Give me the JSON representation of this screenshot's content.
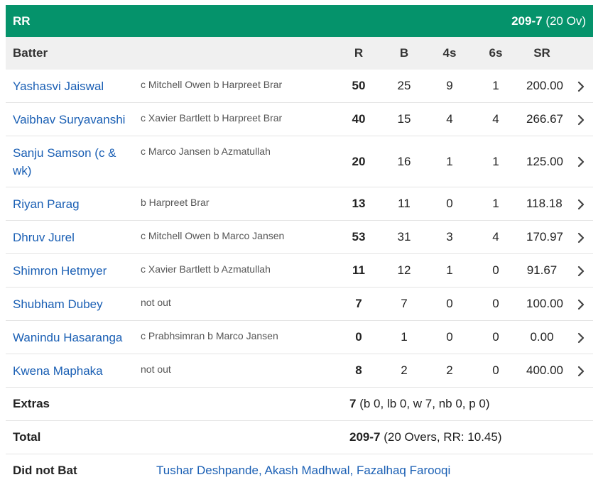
{
  "team": {
    "name": "RR",
    "score": "209-7",
    "overs": "(20 Ov)"
  },
  "columns": {
    "batter": "Batter",
    "runs": "R",
    "balls": "B",
    "fours": "4s",
    "sixes": "6s",
    "strike_rate": "SR"
  },
  "batters": [
    {
      "name": "Yashasvi Jaiswal",
      "dismissal": "c Mitchell Owen b Harpreet Brar",
      "r": "50",
      "b": "25",
      "fours": "9",
      "sixes": "1",
      "sr": "200.00"
    },
    {
      "name": "Vaibhav Suryavanshi",
      "dismissal": "c Xavier Bartlett b Harpreet Brar",
      "r": "40",
      "b": "15",
      "fours": "4",
      "sixes": "4",
      "sr": "266.67"
    },
    {
      "name": "Sanju Samson (c & wk)",
      "dismissal": "c Marco Jansen b Azmatullah",
      "r": "20",
      "b": "16",
      "fours": "1",
      "sixes": "1",
      "sr": "125.00"
    },
    {
      "name": "Riyan Parag",
      "dismissal": "b Harpreet Brar",
      "r": "13",
      "b": "11",
      "fours": "0",
      "sixes": "1",
      "sr": "118.18"
    },
    {
      "name": "Dhruv Jurel",
      "dismissal": "c Mitchell Owen b Marco Jansen",
      "r": "53",
      "b": "31",
      "fours": "3",
      "sixes": "4",
      "sr": "170.97"
    },
    {
      "name": "Shimron Hetmyer",
      "dismissal": "c Xavier Bartlett b Azmatullah",
      "r": "11",
      "b": "12",
      "fours": "1",
      "sixes": "0",
      "sr": "91.67"
    },
    {
      "name": "Shubham Dubey",
      "dismissal": "not out",
      "r": "7",
      "b": "7",
      "fours": "0",
      "sixes": "0",
      "sr": "100.00"
    },
    {
      "name": "Wanindu Hasaranga",
      "dismissal": "c Prabhsimran b Marco Jansen",
      "r": "0",
      "b": "1",
      "fours": "0",
      "sixes": "0",
      "sr": "0.00"
    },
    {
      "name": "Kwena Maphaka",
      "dismissal": "not out",
      "r": "8",
      "b": "2",
      "fours": "2",
      "sixes": "0",
      "sr": "400.00"
    }
  ],
  "extras": {
    "label": "Extras",
    "total": "7",
    "detail": "(b 0, lb 0, w 7, nb 0, p 0)"
  },
  "total": {
    "label": "Total",
    "score": "209-7",
    "detail": "(20 Overs, RR: 10.45)"
  },
  "did_not_bat": {
    "label": "Did not Bat",
    "players": [
      "Tushar Deshpande",
      "Akash Madhwal",
      "Fazalhaq Farooqi"
    ]
  },
  "colors": {
    "header_bg": "#05936b",
    "link": "#1a5fb4",
    "column_header_bg": "#f0f0f0"
  },
  "icons": {
    "row_arrow": "chevron-right-icon"
  }
}
